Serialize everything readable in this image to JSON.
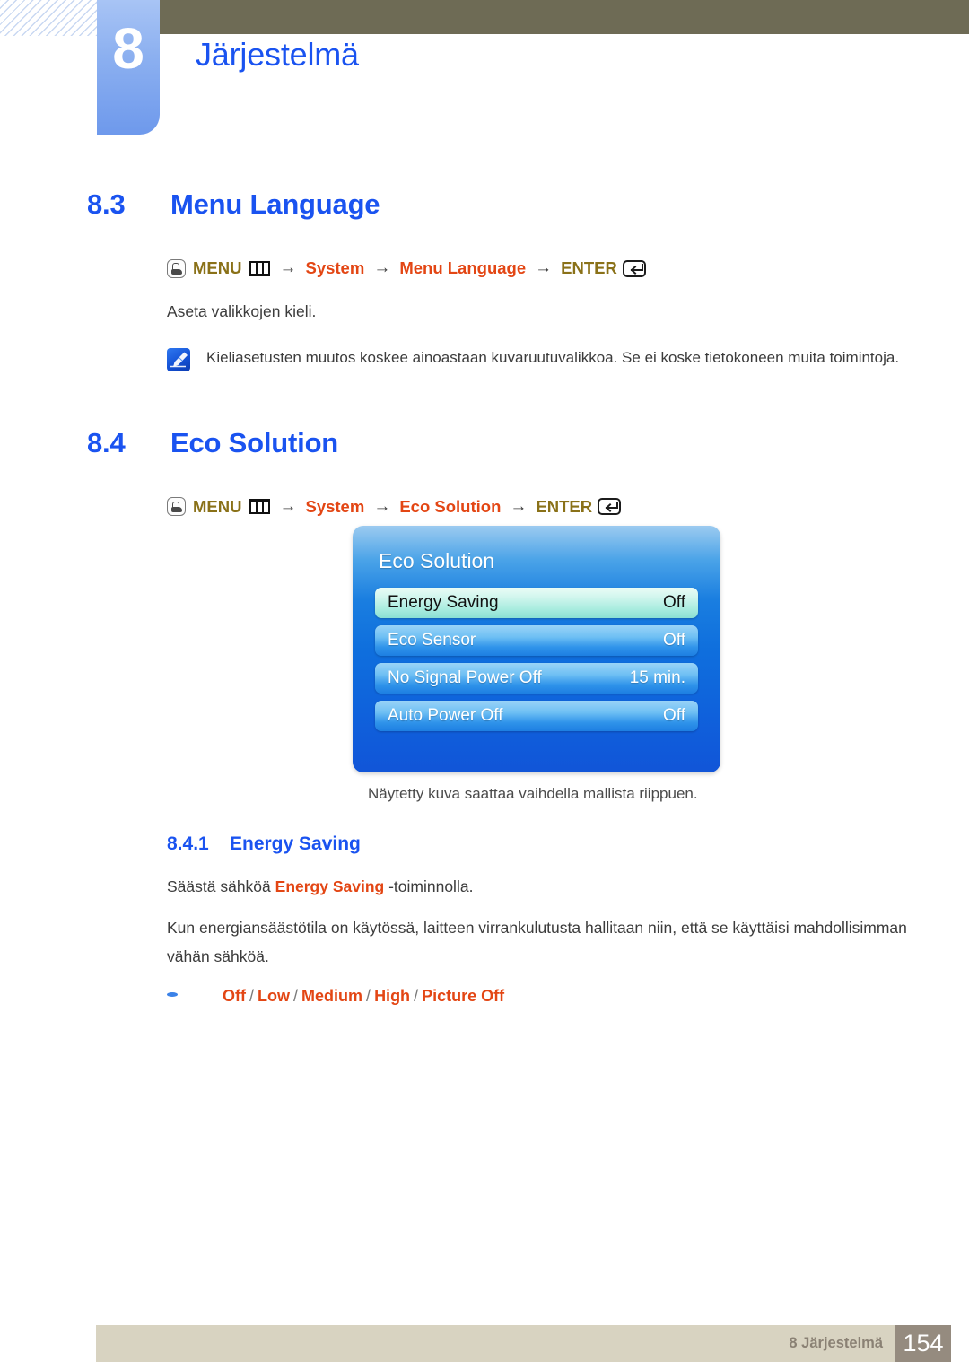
{
  "header": {
    "chapter_number": "8",
    "chapter_title": "Järjestelmä",
    "topbar_color": "#6e6b55",
    "chapter_block_color": "#8cb0f0",
    "heading_color": "#1a53f0"
  },
  "sections": [
    {
      "number": "8.3",
      "title": "Menu Language",
      "path": {
        "press_icon": "hand-press-icon",
        "menu_label": "MENU",
        "menu_icon": "menu-grid-icon",
        "arrow": "→",
        "crumbs": [
          "System",
          "Menu Language"
        ],
        "enter_label": "ENTER",
        "enter_icon": "enter-return-icon"
      },
      "body": "Aseta valikkojen kieli.",
      "note": {
        "icon": "note-pencil-icon",
        "text": "Kieliasetusten muutos koskee ainoastaan kuvaruutuvalikkoa. Se ei koske tietokoneen muita toimintoja."
      }
    },
    {
      "number": "8.4",
      "title": "Eco Solution",
      "path": {
        "press_icon": "hand-press-icon",
        "menu_label": "MENU",
        "menu_icon": "menu-grid-icon",
        "arrow": "→",
        "crumbs": [
          "System",
          "Eco Solution"
        ],
        "enter_label": "ENTER",
        "enter_icon": "enter-return-icon"
      },
      "caption": "Näytetty kuva saattaa vaihdella mallista riippuen."
    }
  ],
  "osd": {
    "title": "Eco Solution",
    "rows": [
      {
        "label": "Energy Saving",
        "value": "Off",
        "selected": true
      },
      {
        "label": "Eco Sensor",
        "value": "Off",
        "selected": false
      },
      {
        "label": "No Signal Power Off",
        "value": "15 min.",
        "selected": false
      },
      {
        "label": "Auto Power Off",
        "value": "Off",
        "selected": false
      }
    ],
    "selected_bg": "#a9ecdf",
    "panel_bg": "#0f6fdd"
  },
  "subsection": {
    "number": "8.4.1",
    "title": "Energy Saving",
    "line1_pre": "Säästä sähköä ",
    "line1_hl": "Energy Saving",
    "line1_post": " -toiminnolla.",
    "paragraph": "Kun energiansäästötila on käytössä, laitteen virrankulutusta hallitaan niin, että se käyttäisi mahdollisimman vähän sähköä.",
    "options": [
      "Off",
      "Low",
      "Medium",
      "High",
      "Picture Off"
    ],
    "option_separator": "/",
    "option_color": "#e34614"
  },
  "footer": {
    "label": "8 Järjestelmä",
    "page": "154",
    "bar_color": "#d8d3c1",
    "page_box_color": "#958b7f"
  }
}
